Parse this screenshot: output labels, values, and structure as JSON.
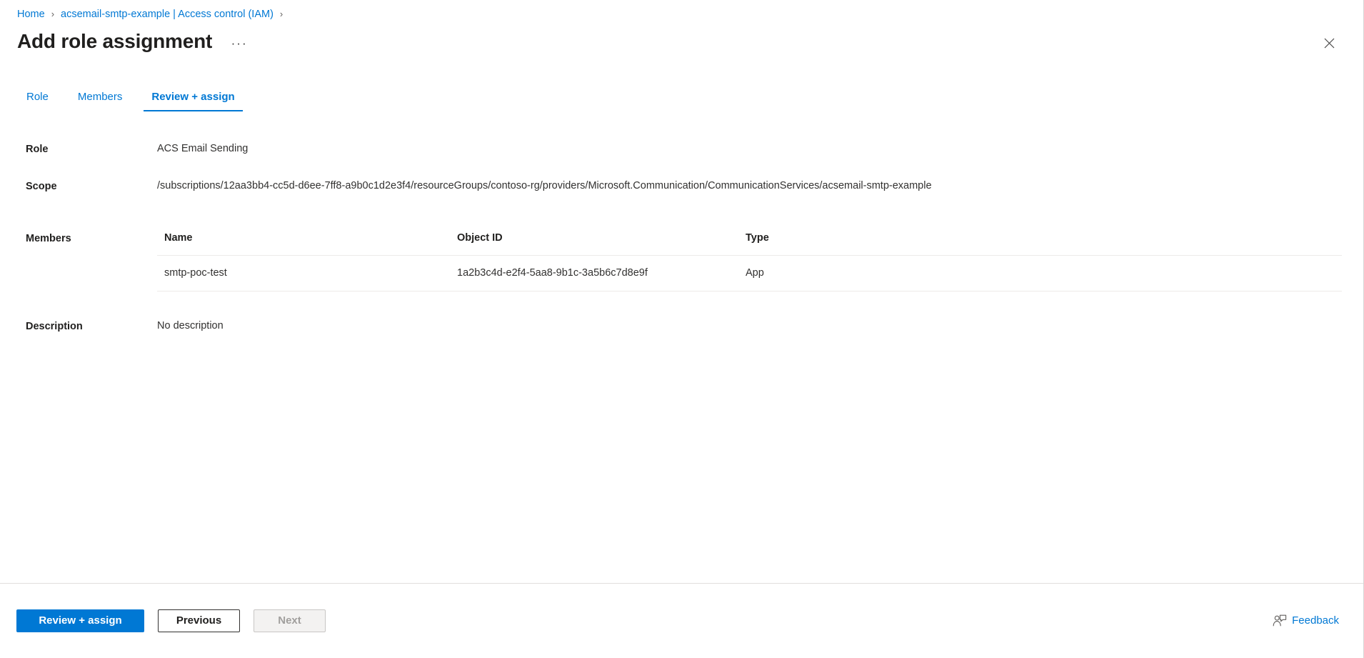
{
  "breadcrumb": {
    "items": [
      {
        "label": "Home"
      },
      {
        "label": "acsemail-smtp-example | Access control (IAM)"
      }
    ],
    "separator": "›"
  },
  "header": {
    "title": "Add role assignment",
    "ellipsis_label": "···",
    "close_icon": "close-icon"
  },
  "tabs": [
    {
      "label": "Role",
      "active": false
    },
    {
      "label": "Members",
      "active": false
    },
    {
      "label": "Review + assign",
      "active": true
    }
  ],
  "fields": {
    "role": {
      "label": "Role",
      "value": "ACS Email Sending"
    },
    "scope": {
      "label": "Scope",
      "value": "/subscriptions/12aa3bb4-cc5d-d6ee-7ff8-a9b0c1d2e3f4/resourceGroups/contoso-rg/providers/Microsoft.Communication/CommunicationServices/acsemail-smtp-example"
    },
    "members": {
      "label": "Members",
      "columns": [
        "Name",
        "Object ID",
        "Type"
      ],
      "rows": [
        {
          "name": "smtp-poc-test",
          "object_id": "1a2b3c4d-e2f4-5aa8-9b1c-3a5b6c7d8e9f",
          "type": "App"
        }
      ]
    },
    "description": {
      "label": "Description",
      "value": "No description"
    }
  },
  "footer": {
    "primary_button": "Review + assign",
    "previous_button": "Previous",
    "next_button": "Next",
    "feedback_label": "Feedback",
    "feedback_icon": "feedback-person-icon"
  },
  "colors": {
    "accent": "#0078d4",
    "text_primary": "#201f1e",
    "text_secondary": "#323130",
    "border": "#edebe9",
    "disabled_text": "#a19f9d",
    "disabled_bg": "#f3f2f1"
  }
}
